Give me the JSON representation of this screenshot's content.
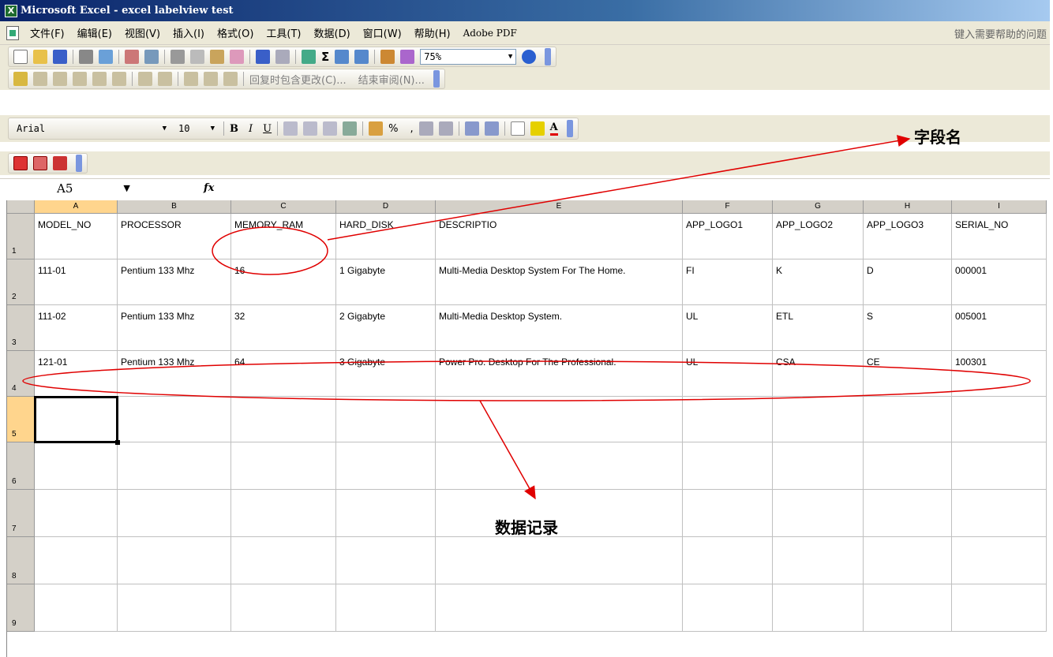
{
  "window": {
    "title": "Microsoft Excel - excel labelview test",
    "logo": "X"
  },
  "menubar": {
    "items": [
      "文件(F)",
      "编辑(E)",
      "视图(V)",
      "插入(I)",
      "格式(O)",
      "工具(T)",
      "数据(D)",
      "窗口(W)",
      "帮助(H)",
      "Adobe PDF"
    ],
    "help_placeholder": "键入需要帮助的问题"
  },
  "standard_toolbar": {
    "zoom": "75%"
  },
  "review_toolbar": {
    "reply_changes": "回复时包含更改(C)...",
    "end_review": "结束审阅(N)..."
  },
  "format_toolbar": {
    "font": "Arial",
    "size": "10",
    "bold": "B",
    "italic": "I",
    "underline": "U",
    "percent": "%",
    "comma": ",",
    "font_color": "A"
  },
  "formula_bar": {
    "name_box": "A5",
    "fx": "fx"
  },
  "sheet": {
    "columns": [
      "A",
      "B",
      "C",
      "D",
      "E",
      "F",
      "G",
      "H",
      "I"
    ],
    "rows": [
      "1",
      "2",
      "3",
      "4",
      "5",
      "6",
      "7",
      "8",
      "9"
    ],
    "cells": [
      [
        "MODEL_NO",
        "PROCESSOR",
        "MEMORY_RAM",
        "HARD_DISK",
        "DESCRIPTIO",
        "APP_LOGO1",
        "APP_LOGO2",
        "APP_LOGO3",
        "SERIAL_NO"
      ],
      [
        "111-01",
        "Pentium 133 Mhz",
        "16",
        "1 Gigabyte",
        "Multi-Media Desktop System For The Home.",
        "FI",
        "K",
        "D",
        "000001"
      ],
      [
        "111-02",
        "Pentium 133 Mhz",
        "32",
        "2 Gigabyte",
        "Multi-Media Desktop System.",
        "UL",
        "ETL",
        "S",
        "005001"
      ],
      [
        "121-01",
        "Pentium 133 Mhz",
        "64",
        "3 Gigabyte",
        "Power Pro. Desktop For The Professional.",
        "UL",
        "CSA",
        "CE",
        "100301"
      ],
      [
        "",
        "",
        "",
        "",
        "",
        "",
        "",
        "",
        ""
      ],
      [
        "",
        "",
        "",
        "",
        "",
        "",
        "",
        "",
        ""
      ],
      [
        "",
        "",
        "",
        "",
        "",
        "",
        "",
        "",
        ""
      ],
      [
        "",
        "",
        "",
        "",
        "",
        "",
        "",
        "",
        ""
      ],
      [
        "",
        "",
        "",
        "",
        "",
        "",
        "",
        "",
        ""
      ]
    ]
  },
  "annotations": {
    "field_name": "字段名",
    "data_record": "数据记录"
  },
  "colors": {
    "annotation": "#e00000",
    "title_start": "#0a246a",
    "title_end": "#a6caf0"
  }
}
